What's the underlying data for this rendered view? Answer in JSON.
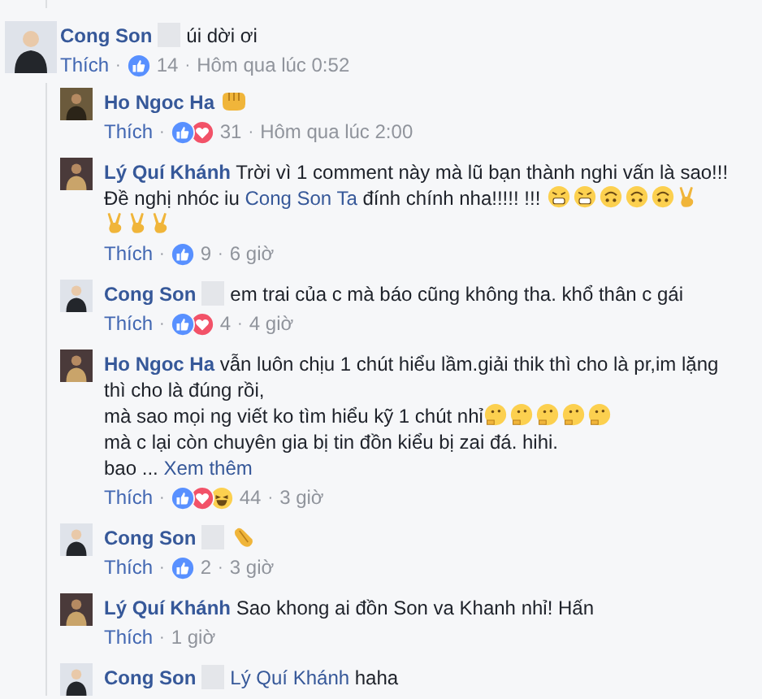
{
  "comment": {
    "author": "Cong Son",
    "redacted": true,
    "lines": [
      [
        {
          "kind": "text",
          "text": "úi dời ơi"
        }
      ]
    ],
    "meta": {
      "like": "Thích",
      "sep1": "·",
      "reactions": [
        {
          "kind": "like"
        }
      ],
      "count": "14",
      "sep2": "·",
      "time": "Hôm qua lúc 0:52"
    }
  },
  "replies": [
    {
      "author": "Ho Ngoc Ha",
      "redacted": false,
      "lines": [
        [
          {
            "kind": "fist"
          }
        ]
      ],
      "meta": {
        "like": "Thích",
        "sep1": "·",
        "reactions": [
          {
            "kind": "like"
          },
          {
            "kind": "love"
          }
        ],
        "count": "31",
        "sep2": "·",
        "time": "Hôm qua lúc 2:00"
      }
    },
    {
      "author": "Lý Quí Khánh",
      "redacted": false,
      "lines": [
        [
          {
            "kind": "text",
            "text": "Trời vì 1 comment này mà lũ bạn thành nghi vấn là sao!!!"
          }
        ],
        [
          {
            "kind": "text",
            "text": "Đề nghị nhóc iu "
          },
          {
            "kind": "link",
            "text": "Cong Son Ta"
          },
          {
            "kind": "text",
            "text": " đính chính nha!!!!! !!! "
          },
          {
            "kind": "persevere"
          },
          {
            "kind": "persevere"
          },
          {
            "kind": "upside"
          },
          {
            "kind": "upside"
          },
          {
            "kind": "upside"
          },
          {
            "kind": "victory"
          }
        ],
        [
          {
            "kind": "victory"
          },
          {
            "kind": "victory"
          },
          {
            "kind": "victory"
          }
        ]
      ],
      "meta": {
        "like": "Thích",
        "sep1": "·",
        "reactions": [
          {
            "kind": "like"
          }
        ],
        "count": "9",
        "sep2": "·",
        "time": "6 giờ"
      }
    },
    {
      "author": "Cong Son",
      "redacted": true,
      "lines": [
        [
          {
            "kind": "text",
            "text": "em trai của c mà báo cũng không tha. khổ thân c gái"
          }
        ]
      ],
      "meta": {
        "like": "Thích",
        "sep1": "·",
        "reactions": [
          {
            "kind": "like"
          },
          {
            "kind": "love"
          }
        ],
        "count": "4",
        "sep2": "·",
        "time": "4 giờ"
      }
    },
    {
      "author": "Ho Ngoc Ha",
      "redacted": false,
      "lines": [
        [
          {
            "kind": "text",
            "text": "vẫn luôn chịu 1 chút hiểu lầm.giải thik thì cho là pr,im lặng"
          }
        ],
        [
          {
            "kind": "text",
            "text": "thì cho là đúng rồi,"
          }
        ],
        [
          {
            "kind": "text",
            "text": "mà sao mọi ng viết ko tìm hiểu kỹ 1 chút nhỉ"
          },
          {
            "kind": "thinking"
          },
          {
            "kind": "thinking"
          },
          {
            "kind": "thinking"
          },
          {
            "kind": "thinking"
          },
          {
            "kind": "thinking"
          }
        ],
        [
          {
            "kind": "text",
            "text": "mà c lại còn chuyên gia bị tin đồn kiểu bị zai đá. hihi."
          }
        ],
        [
          {
            "kind": "text",
            "text": "bao ... "
          },
          {
            "kind": "more",
            "text": "Xem thêm"
          }
        ]
      ],
      "meta": {
        "like": "Thích",
        "sep1": "·",
        "reactions": [
          {
            "kind": "like"
          },
          {
            "kind": "love"
          },
          {
            "kind": "haha"
          }
        ],
        "count": "44",
        "sep2": "·",
        "time": "3 giờ"
      }
    },
    {
      "author": "Cong Son",
      "redacted": true,
      "lines": [
        [
          {
            "kind": "clap"
          }
        ]
      ],
      "meta": {
        "like": "Thích",
        "sep1": "·",
        "reactions": [
          {
            "kind": "like"
          }
        ],
        "count": "2",
        "sep2": "·",
        "time": "3 giờ"
      }
    },
    {
      "author": "Lý Quí Khánh",
      "redacted": false,
      "lines": [
        [
          {
            "kind": "text",
            "text": "Sao khong ai đồn Son va Khanh nhỉ! Hấn"
          }
        ]
      ],
      "meta": {
        "like": "Thích",
        "sep1": "·",
        "time": "1 giờ"
      }
    },
    {
      "author": "Cong Son",
      "redacted": true,
      "lines": [
        [
          {
            "kind": "link",
            "text": "Lý Quí Khánh"
          },
          {
            "kind": "text",
            "text": " haha"
          }
        ]
      ]
    }
  ]
}
